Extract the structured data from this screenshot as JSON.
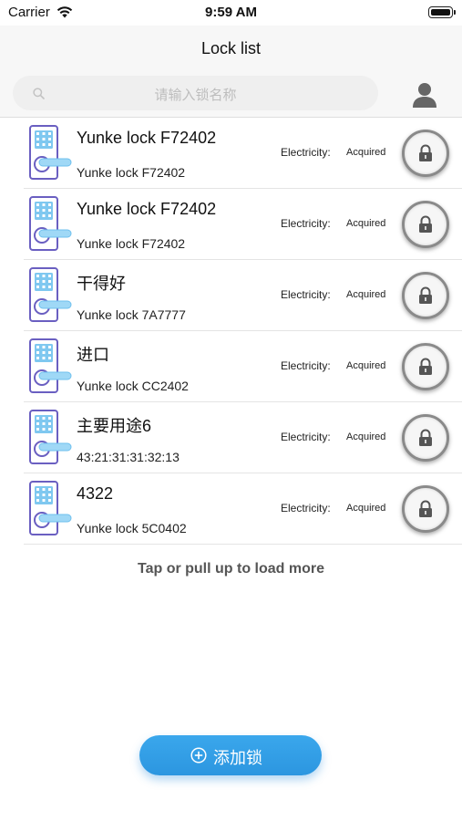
{
  "status": {
    "carrier": "Carrier",
    "time": "9:59 AM"
  },
  "header": {
    "title": "Lock list"
  },
  "search": {
    "placeholder": "请输入锁名称"
  },
  "locks": [
    {
      "name": "Yunke lock F72402",
      "id": "Yunke lock F72402",
      "electricity_label": "Electricity:",
      "electricity_value": "Acquired"
    },
    {
      "name": "Yunke lock F72402",
      "id": "Yunke lock F72402",
      "electricity_label": "Electricity:",
      "electricity_value": "Acquired"
    },
    {
      "name": "干得好",
      "id": "Yunke lock 7A7777",
      "electricity_label": "Electricity:",
      "electricity_value": "Acquired"
    },
    {
      "name": "进口",
      "id": "Yunke lock CC2402",
      "electricity_label": "Electricity:",
      "electricity_value": "Acquired"
    },
    {
      "name": "主要用途6",
      "id": "43:21:31:31:32:13",
      "electricity_label": "Electricity:",
      "electricity_value": "Acquired"
    },
    {
      "name": "4322",
      "id": "Yunke lock 5C0402",
      "electricity_label": "Electricity:",
      "electricity_value": "Acquired"
    }
  ],
  "footer": {
    "load_more": "Tap or pull up to load more"
  },
  "add_button": {
    "label": "添加锁"
  },
  "icons": {
    "wifi": "wifi-icon",
    "battery": "battery-icon",
    "search": "search-icon",
    "user": "user-icon",
    "lock_device": "smart-lock-icon",
    "padlock": "padlock-icon",
    "add": "plus-circle-icon"
  },
  "colors": {
    "accent": "#2f9be4",
    "device_outline": "#6a5fc1",
    "device_keypad": "#7fc8f0"
  }
}
